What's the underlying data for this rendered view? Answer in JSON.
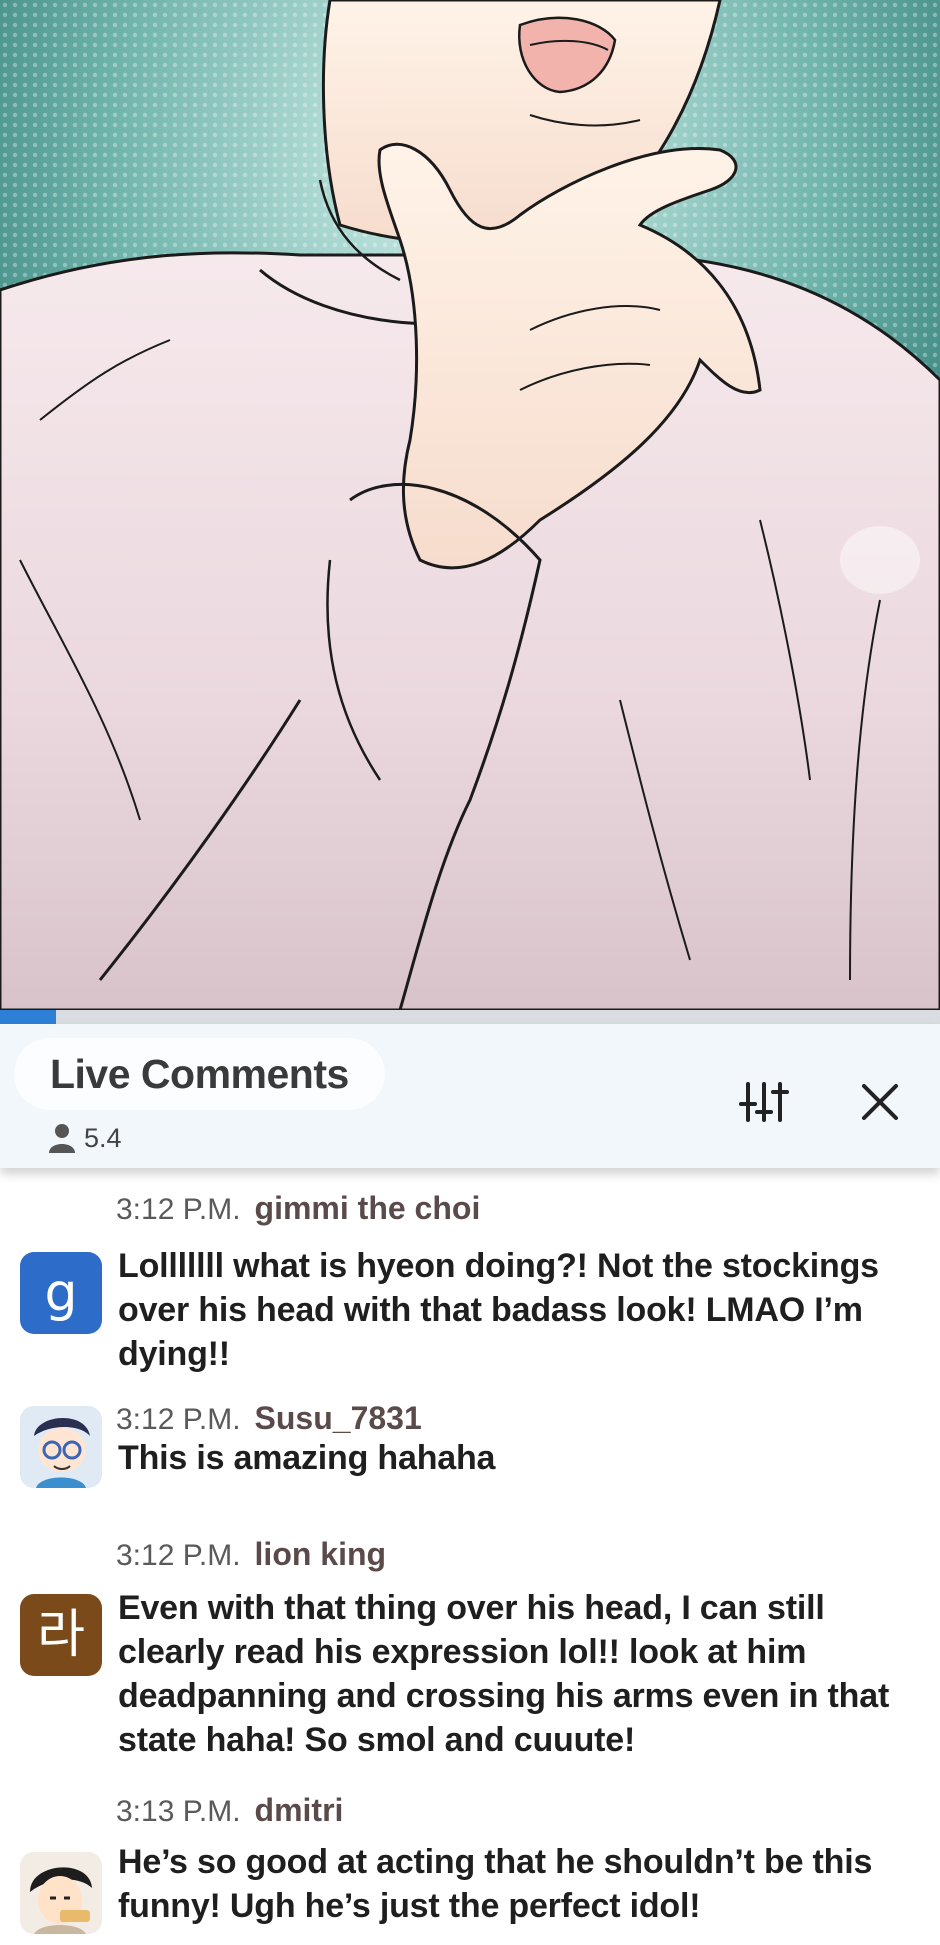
{
  "panel": {
    "description_icon": "comic-panel-icon",
    "progress": 0.06
  },
  "live_comments": {
    "title": "Live Comments",
    "viewer_icon": "person-icon",
    "viewer_count": "5.4",
    "filter_icon": "sliders-icon",
    "close_icon": "close-icon"
  },
  "comments": [
    {
      "time": "3:12 P.M.",
      "user": "gimmi the choi",
      "avatar_letter": "g",
      "avatar_color": "#2d6cc9",
      "text": "Lolllllll what is hyeon doing?! Not the stockings over his head with that badass look! LMAO I’m dying!!"
    },
    {
      "time": "3:12 P.M.",
      "user": "Susu_7831",
      "avatar_letter": "",
      "avatar_color": "#e6eef6",
      "text": "This is amazing hahaha"
    },
    {
      "time": "3:12 P.M.",
      "user": "lion king",
      "avatar_letter": "라",
      "avatar_color": "#7a4a1a",
      "text": "Even with that thing over his head, I can still clearly read his expression lol!! look at him deadpanning and crossing his arms even in that state haha! So smol and cuuute!"
    },
    {
      "time": "3:13 P.M.",
      "user": "dmitri",
      "avatar_letter": "",
      "avatar_color": "#f3e2cf",
      "text": "He’s so good at acting that he shouldn’t be this funny! Ugh he’s just the perfect idol!"
    }
  ]
}
